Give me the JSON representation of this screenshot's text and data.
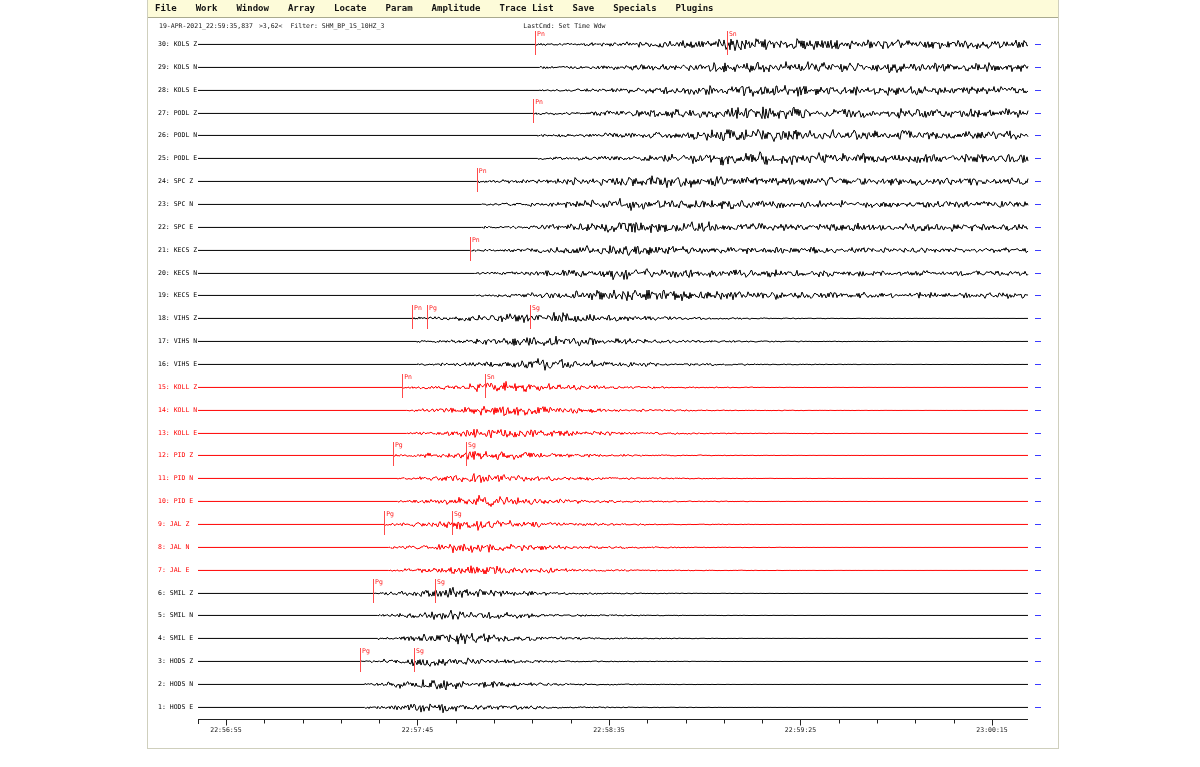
{
  "menu": [
    "File",
    "Work",
    "Window",
    "Array",
    "Locate",
    "Param",
    "Amplitude",
    "Trace List",
    "Save",
    "Specials",
    "Plugins"
  ],
  "header": {
    "timestamp": "19-APR-2021_22:59:35,837",
    "zoom": ">3,62<",
    "filter": "Filter: SHM_BP_1S_10HZ_3",
    "last_command": "LastCmd: Set Time Wdw"
  },
  "traces": [
    {
      "label": "30: KOLS Z",
      "color": "#000000",
      "picks": [
        "Pn",
        "Sn"
      ]
    },
    {
      "label": "29: KOLS N",
      "color": "#000000"
    },
    {
      "label": "28: KOLS E",
      "color": "#000000"
    },
    {
      "label": "27: PODL Z",
      "color": "#000000",
      "picks": [
        "Pn"
      ]
    },
    {
      "label": "26: PODL N",
      "color": "#000000"
    },
    {
      "label": "25: PODL E",
      "color": "#000000"
    },
    {
      "label": "24: SPC Z",
      "color": "#000000",
      "picks": [
        "Pn"
      ]
    },
    {
      "label": "23: SPC N",
      "color": "#000000"
    },
    {
      "label": "22: SPC E",
      "color": "#000000"
    },
    {
      "label": "21: KECS Z",
      "color": "#000000",
      "picks": [
        "Pn"
      ]
    },
    {
      "label": "20: KECS N",
      "color": "#000000"
    },
    {
      "label": "19: KECS E",
      "color": "#000000"
    },
    {
      "label": "18: VIHS Z",
      "color": "#000000",
      "picks": [
        "Pn",
        "Pg",
        "Sg"
      ]
    },
    {
      "label": "17: VIHS N",
      "color": "#000000"
    },
    {
      "label": "16: VIHS E",
      "color": "#000000"
    },
    {
      "label": "15: KOLL Z",
      "color": "#ff0000",
      "picks": [
        "Pn",
        "Sn"
      ]
    },
    {
      "label": "14: KOLL N",
      "color": "#ff0000"
    },
    {
      "label": "13: KOLL E",
      "color": "#ff0000"
    },
    {
      "label": "12: PID Z",
      "color": "#ff0000",
      "picks": [
        "Pg",
        "Sg"
      ]
    },
    {
      "label": "11: PID N",
      "color": "#ff0000"
    },
    {
      "label": "10: PID E",
      "color": "#ff0000"
    },
    {
      "label": "9: JAL Z",
      "color": "#ff0000",
      "picks": [
        "Pg",
        "Sg"
      ]
    },
    {
      "label": "8: JAL N",
      "color": "#ff0000"
    },
    {
      "label": "7: JAL E",
      "color": "#ff0000"
    },
    {
      "label": "6: SMIL Z",
      "color": "#000000",
      "picks": [
        "Pg",
        "Sg"
      ]
    },
    {
      "label": "5: SMIL N",
      "color": "#000000"
    },
    {
      "label": "4: SMIL E",
      "color": "#000000"
    },
    {
      "label": "3: HODS Z",
      "color": "#000000",
      "picks": [
        "Pg",
        "Sg"
      ]
    },
    {
      "label": "2: HODS N",
      "color": "#000000"
    },
    {
      "label": "1: HODS E",
      "color": "#000000"
    }
  ],
  "time_axis": {
    "ticks": [
      "22:56:55",
      "22:57:45",
      "22:58:35",
      "22:59:25",
      "23:00:15"
    ]
  }
}
